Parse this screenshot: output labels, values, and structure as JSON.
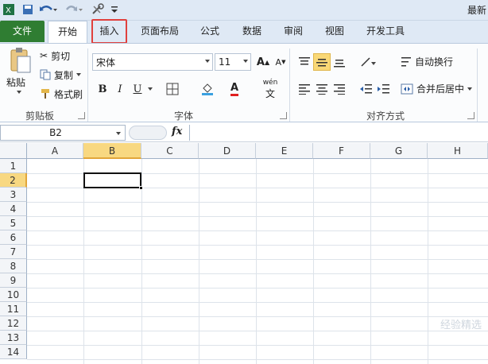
{
  "title_bar": {
    "title": "最新"
  },
  "quick_access": {
    "icons": [
      "excel-logo",
      "save",
      "undo",
      "redo",
      "customize-tools",
      "dropdown"
    ]
  },
  "tabs": [
    {
      "id": "file",
      "label": "文件"
    },
    {
      "id": "home",
      "label": "开始"
    },
    {
      "id": "insert",
      "label": "插入"
    },
    {
      "id": "page_layout",
      "label": "页面布局"
    },
    {
      "id": "formulas",
      "label": "公式"
    },
    {
      "id": "data",
      "label": "数据"
    },
    {
      "id": "review",
      "label": "审阅"
    },
    {
      "id": "view",
      "label": "视图"
    },
    {
      "id": "developer",
      "label": "开发工具"
    }
  ],
  "ribbon": {
    "clipboard": {
      "paste": "粘贴",
      "cut": "剪切",
      "copy": "复制",
      "format_painter": "格式刷",
      "label": "剪贴板"
    },
    "font": {
      "name": "宋体",
      "size": "11",
      "bold": "B",
      "italic": "I",
      "underline": "U",
      "label": "字体",
      "grow": "A",
      "shrink": "A",
      "font_color": "A",
      "phonetic": "wén"
    },
    "alignment": {
      "wrap_text": "自动换行",
      "merge_center": "合并后居中",
      "label": "对齐方式"
    }
  },
  "formula_bar": {
    "name_box": "B2",
    "fx": "fx",
    "value": ""
  },
  "grid": {
    "columns": [
      "A",
      "B",
      "C",
      "D",
      "E",
      "F",
      "G",
      "H"
    ],
    "rows": [
      "1",
      "2",
      "3",
      "4",
      "5",
      "6",
      "7",
      "8",
      "9",
      "10",
      "11",
      "12",
      "13",
      "14"
    ],
    "active_column": "B",
    "active_row": "2"
  },
  "watermark": "经验精选",
  "colors": {
    "file_tab": "#2f7d32",
    "highlight_border": "#e0403d",
    "active_header": "#f8d881"
  }
}
